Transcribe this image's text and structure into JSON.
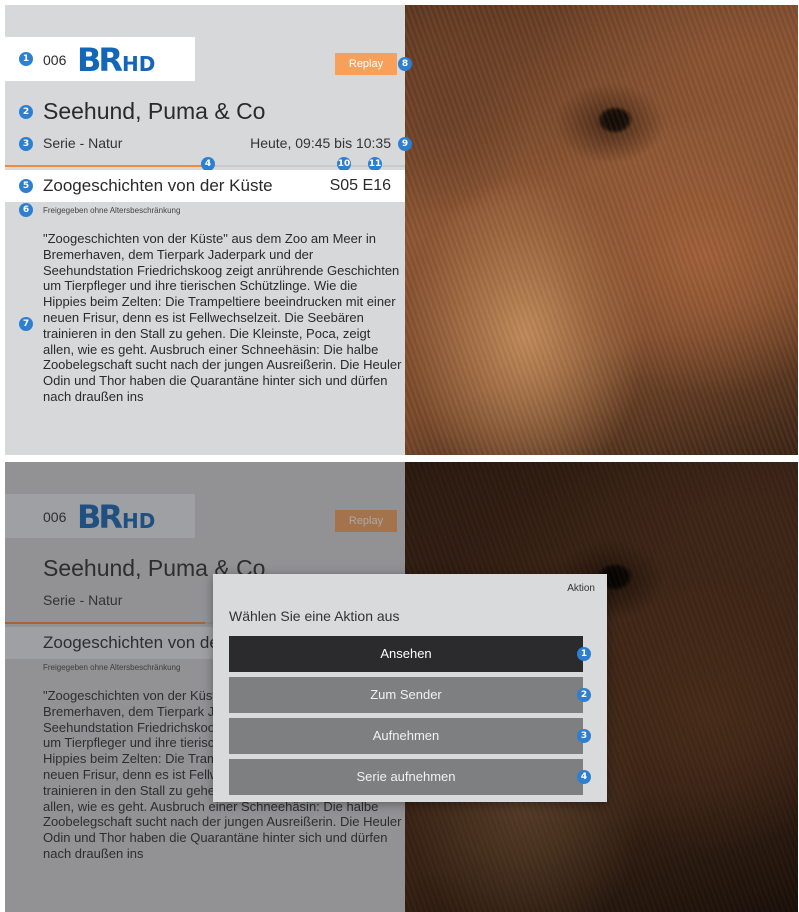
{
  "colors": {
    "accent_orange": "#f28a3c",
    "replay_orange": "#f7a05a",
    "brand_blue": "#1466b8",
    "marker_blue": "#2f7fd1",
    "selected_action": "#2b2b2d",
    "action_button": "#7e7f80"
  },
  "program": {
    "channel_number": "006",
    "channel_logo_main": "BR",
    "channel_logo_suffix": "HD",
    "replay_label": "Replay",
    "title": "Seehund, Puma & Co",
    "genre": "Serie - Natur",
    "airtime": "Heute, 09:45 bis 10:35",
    "progress": 0.5,
    "episode_title": "Zoogeschichten von der Küste",
    "episode_code": "S05 E16",
    "rating": "Freigegeben ohne Altersbeschränkung",
    "description": "\"Zoogeschichten von der Küste\" aus dem Zoo am Meer in Bremerhaven, dem Tierpark Jaderpark und der Seehundstation Friedrichskoog zeigt anrührende Geschichten um Tierpfleger und ihre tierischen Schützlinge. Wie die Hippies beim Zelten: Die Trampeltiere beeindrucken mit einer neuen Frisur, denn es ist Fellwechselzeit. Die Seebären trainieren in den Stall zu gehen. Die Kleinste, Poca, zeigt allen, wie es geht. Ausbruch einer Schneehäsin: Die halbe Zoobelegschaft sucht nach der jungen Ausreißerin. Die Heuler Odin und Thor haben die Quarantäne hinter sich und dürfen nach draußen ins"
  },
  "markers": {
    "m1": "1",
    "m2": "2",
    "m3": "3",
    "m4": "4",
    "m5": "5",
    "m6": "6",
    "m7": "7",
    "m8": "8",
    "m9": "9",
    "m10": "10",
    "m11": "11"
  },
  "dialog": {
    "title": "Aktion",
    "prompt": "Wählen Sie eine Aktion aus",
    "actions": [
      {
        "label": "Ansehen",
        "marker": "1"
      },
      {
        "label": "Zum Sender",
        "marker": "2"
      },
      {
        "label": "Aufnehmen",
        "marker": "3"
      },
      {
        "label": "Serie aufnehmen",
        "marker": "4"
      }
    ]
  }
}
